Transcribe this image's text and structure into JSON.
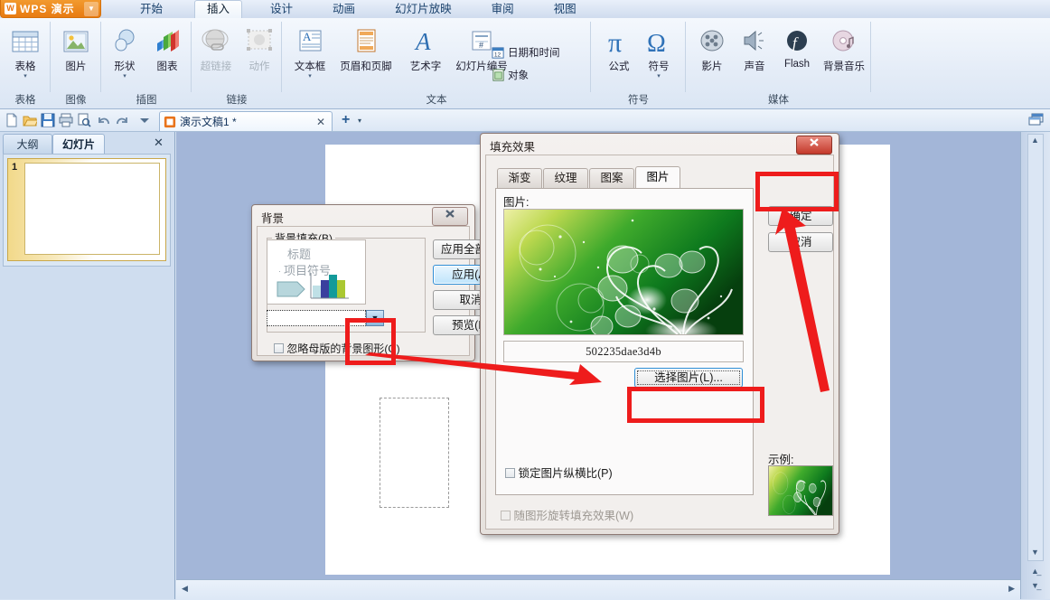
{
  "app": {
    "logo_label": "WPS 演示",
    "logo_mark": "W",
    "logo_caret": "▼"
  },
  "ribbon": {
    "tabs": [
      {
        "label": "开始",
        "active": false
      },
      {
        "label": "插入",
        "active": true
      },
      {
        "label": "设计",
        "active": false
      },
      {
        "label": "动画",
        "active": false
      },
      {
        "label": "幻灯片放映",
        "active": false
      },
      {
        "label": "审阅",
        "active": false
      },
      {
        "label": "视图",
        "active": false
      }
    ],
    "groups": [
      {
        "name": "表格",
        "items": [
          {
            "label": "表格",
            "icon": "table-icon",
            "caret": "▾"
          }
        ]
      },
      {
        "name": "图像",
        "items": [
          {
            "label": "图片",
            "icon": "picture-icon",
            "caret": ""
          }
        ]
      },
      {
        "name": "插图",
        "items": [
          {
            "label": "形状",
            "icon": "shapes-icon",
            "caret": "▾"
          },
          {
            "label": "图表",
            "icon": "chart-icon",
            "caret": ""
          }
        ]
      },
      {
        "name": "链接",
        "items": [
          {
            "label": "超链接",
            "icon": "hyperlink-icon",
            "caret": "",
            "disabled": true
          },
          {
            "label": "动作",
            "icon": "action-icon",
            "caret": "",
            "disabled": true
          }
        ]
      },
      {
        "name": "文本",
        "items": [
          {
            "label": "文本框",
            "icon": "textbox-icon",
            "caret": "▾"
          },
          {
            "label": "页眉和页脚",
            "icon": "header-footer-icon",
            "caret": ""
          },
          {
            "label": "艺术字",
            "icon": "wordart-icon",
            "caret": ""
          },
          {
            "label": "幻灯片编号",
            "icon": "slide-number-icon",
            "caret": ""
          }
        ],
        "small_items": [
          {
            "label": "日期和时间",
            "icon": "date-time-icon"
          },
          {
            "label": "对象",
            "icon": "object-icon"
          }
        ]
      },
      {
        "name": "符号",
        "items": [
          {
            "label": "公式",
            "icon": "formula-pi-icon",
            "caret": ""
          },
          {
            "label": "符号",
            "icon": "symbol-omega-icon",
            "caret": "▾"
          }
        ]
      },
      {
        "name": "媒体",
        "items": [
          {
            "label": "影片",
            "icon": "movie-icon",
            "caret": ""
          },
          {
            "label": "声音",
            "icon": "sound-icon",
            "caret": ""
          },
          {
            "label": "Flash",
            "icon": "flash-icon",
            "caret": ""
          },
          {
            "label": "背景音乐",
            "icon": "background-music-icon",
            "caret": ""
          }
        ]
      }
    ]
  },
  "quick_access": {
    "icons": [
      "new-icon",
      "open-icon",
      "save-icon",
      "print-icon",
      "print-preview-icon",
      "undo-icon",
      "redo-icon",
      "customize-icon"
    ],
    "document_tab": "演示文稿1 *",
    "document_tab_close": "✕",
    "new_tab_plus": "+",
    "new_tab_caret": "▾"
  },
  "left_panel": {
    "tab_outline": "大纲",
    "tab_slides": "幻灯片",
    "close": "✕",
    "slide_number": "1"
  },
  "background_dialog": {
    "title": "背景",
    "close": "✕",
    "group_label": "背景填充(B)",
    "preview": {
      "title_text": "标题",
      "bullet_text": "项目符号",
      "bullet_mark": "·"
    },
    "combo_value": "",
    "combo_caret": "▼",
    "checkbox_ignore_master": "忽略母版的背景图形(G)",
    "buttons": {
      "apply_all": "应用全部(T)",
      "apply": "应用(A)",
      "cancel": "取消",
      "preview": "预览(P)"
    }
  },
  "fill_effects_dialog": {
    "title": "填充效果",
    "close": "✕",
    "tabs": [
      {
        "label": "渐变",
        "active": false
      },
      {
        "label": "纹理",
        "active": false
      },
      {
        "label": "图案",
        "active": false
      },
      {
        "label": "图片",
        "active": true
      }
    ],
    "picture_label": "图片:",
    "picture_name": "502235dae3d4b",
    "choose_picture_button": "选择图片(L)...",
    "lock_aspect_checkbox": "锁定图片纵横比(P)",
    "rotate_with_shape_checkbox": "随图形旋转填充效果(W)",
    "sample_label": "示例:",
    "ok_button": "确定",
    "cancel_button": "取消"
  },
  "colors": {
    "accent_red": "#ee1c1c",
    "workspace_bg": "#a3b6d8",
    "ribbon_bg": "#e4ecf7",
    "logo_orange": "#e87b12",
    "image_green_light": "#e9f0a0",
    "image_green_dark": "#0a4a12"
  }
}
